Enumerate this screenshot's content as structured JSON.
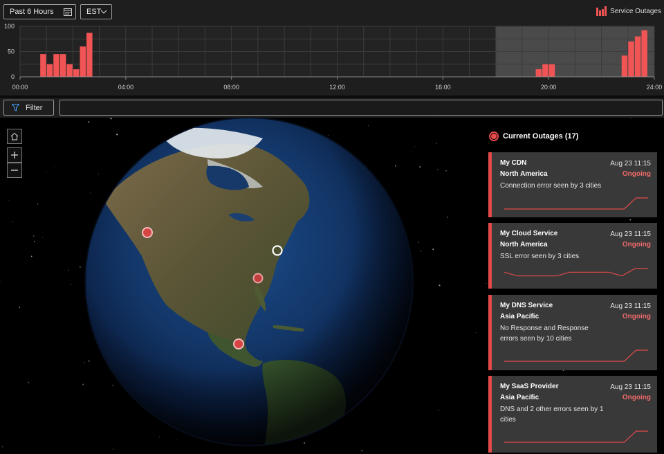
{
  "toolbar": {
    "time_range": "Past 6 Hours",
    "timezone": "EST",
    "legend_label": "Service Outages",
    "filter_label": "Filter",
    "filter_value": ""
  },
  "colors": {
    "accent": "#f05454",
    "ongoing": "#f06a6a",
    "background": "#1e1e1e"
  },
  "chart_data": {
    "type": "bar",
    "title": "",
    "xlabel": "",
    "ylabel": "",
    "ylim": [
      0,
      100
    ],
    "yticks": [
      "0",
      "50",
      "100"
    ],
    "xticks": [
      "00:00",
      "04:00",
      "08:00",
      "12:00",
      "16:00",
      "20:00",
      "24:00"
    ],
    "xlim_hours": [
      0,
      24
    ],
    "highlight_range_hours": [
      18,
      24
    ],
    "bar_width_hours": 0.25,
    "bars": [
      {
        "hour": 0.75,
        "value": 45
      },
      {
        "hour": 1.0,
        "value": 25
      },
      {
        "hour": 1.25,
        "value": 45
      },
      {
        "hour": 1.5,
        "value": 45
      },
      {
        "hour": 1.75,
        "value": 25
      },
      {
        "hour": 2.0,
        "value": 15
      },
      {
        "hour": 2.25,
        "value": 60
      },
      {
        "hour": 2.5,
        "value": 87
      },
      {
        "hour": 19.5,
        "value": 15
      },
      {
        "hour": 19.75,
        "value": 25
      },
      {
        "hour": 20.0,
        "value": 25
      },
      {
        "hour": 22.75,
        "value": 42
      },
      {
        "hour": 23.0,
        "value": 70
      },
      {
        "hour": 23.25,
        "value": 80
      },
      {
        "hour": 23.5,
        "value": 92
      }
    ]
  },
  "map": {
    "markers": [
      {
        "name": "marker-west-coast",
        "type": "outage"
      },
      {
        "name": "marker-east-coast",
        "type": "selected"
      },
      {
        "name": "marker-southeast",
        "type": "outage"
      },
      {
        "name": "marker-central-america",
        "type": "outage"
      }
    ]
  },
  "outages": {
    "title": "Current Outages (17)",
    "cards": [
      {
        "name": "My CDN",
        "time": "Aug 23 11:15",
        "region": "North America",
        "status": "Ongoing",
        "desc": "Connection error seen by 3 cities",
        "trend": [
          0,
          0,
          0,
          0,
          0,
          0,
          0,
          0,
          0,
          0,
          0,
          1,
          1
        ]
      },
      {
        "name": "My Cloud Service",
        "time": "Aug 23 11:15",
        "region": "North America",
        "status": "Ongoing",
        "desc": "SSL error seen by 3 cities",
        "trend": [
          1.0,
          0.5,
          0.5,
          0.5,
          0.5,
          1,
          1,
          1,
          1,
          0.5,
          1.5,
          1.5
        ]
      },
      {
        "name": "My DNS Service",
        "time": "Aug 23 11:15",
        "region": "Asia Pacific",
        "status": "Ongoing",
        "desc": "No Response and Response errors seen by 10 cities",
        "trend": [
          0,
          0,
          0,
          0,
          0,
          0,
          0,
          0,
          0,
          0,
          0,
          1,
          1
        ]
      },
      {
        "name": "My SaaS Provider",
        "time": "Aug 23 11:15",
        "region": "Asia Pacific",
        "status": "Ongoing",
        "desc": "DNS and 2 other errors seen by 1 cities",
        "trend": [
          0,
          0,
          0,
          0,
          0,
          0,
          0,
          0,
          0,
          0,
          0,
          1,
          1
        ]
      }
    ]
  }
}
